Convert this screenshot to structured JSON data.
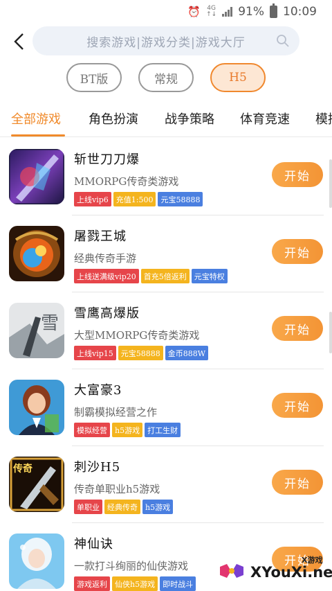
{
  "status_bar": {
    "network_top": "4G",
    "network_bottom": "↑↓",
    "battery": "91%",
    "time": "10:09"
  },
  "search": {
    "placeholder": "搜索游戏|游戏分类|游戏大厅"
  },
  "versions": [
    {
      "label": "BT版",
      "active": false
    },
    {
      "label": "常规",
      "active": false
    },
    {
      "label": "H5",
      "active": true
    }
  ],
  "tabs": [
    {
      "label": "全部游戏",
      "active": true
    },
    {
      "label": "角色扮演",
      "active": false
    },
    {
      "label": "战争策略",
      "active": false
    },
    {
      "label": "体育竞速",
      "active": false
    },
    {
      "label": "模拟",
      "active": false
    }
  ],
  "colors": {
    "accent": "#f08a2b",
    "tag_red": "#e6454a",
    "tag_yellow": "#f4b41e",
    "tag_blue": "#4a7fe0"
  },
  "start_label": "开始",
  "games": [
    {
      "title": "斩世刀刀爆",
      "desc": "MMORPG传奇类游戏",
      "icon": "sword-warrior-game-icon",
      "tags": [
        {
          "text": "上线vip6",
          "color": "red"
        },
        {
          "text": "充值1:500",
          "color": "yellow"
        },
        {
          "text": "元宝58888",
          "color": "blue"
        }
      ]
    },
    {
      "title": "屠戮王城",
      "desc": "经典传奇手游",
      "icon": "fire-orb-game-icon",
      "tags": [
        {
          "text": "上线送满级vip20",
          "color": "red"
        },
        {
          "text": "首充5倍返利",
          "color": "yellow"
        },
        {
          "text": "元宝特权",
          "color": "blue"
        }
      ]
    },
    {
      "title": "雪鹰高爆版",
      "desc": "大型MMORPG传奇类游戏",
      "icon": "snow-eagle-game-icon",
      "tags": [
        {
          "text": "上线vip15",
          "color": "red"
        },
        {
          "text": "元宝58888",
          "color": "yellow"
        },
        {
          "text": "金币888W",
          "color": "blue"
        }
      ]
    },
    {
      "title": "大富豪3",
      "desc": "制霸模拟经营之作",
      "icon": "business-woman-game-icon",
      "tags": [
        {
          "text": "模拟经营",
          "color": "red"
        },
        {
          "text": "h5游戏",
          "color": "yellow"
        },
        {
          "text": "打工生财",
          "color": "blue"
        }
      ]
    },
    {
      "title": "刺沙H5",
      "desc": "传奇单职业h5游戏",
      "icon": "legend-blade-game-icon",
      "tags": [
        {
          "text": "单职业",
          "color": "red"
        },
        {
          "text": "经典传奇",
          "color": "yellow"
        },
        {
          "text": "h5游戏",
          "color": "blue"
        }
      ]
    },
    {
      "title": "神仙诀",
      "desc": "一款打斗绚丽的仙侠游戏",
      "icon": "fairy-game-icon",
      "tags": [
        {
          "text": "游戏返利",
          "color": "red"
        },
        {
          "text": "仙侠h5游戏",
          "color": "yellow"
        },
        {
          "text": "即时战斗",
          "color": "blue"
        }
      ]
    }
  ],
  "thumb_texts": {
    "snow_eagle_char": "雪",
    "legend_label": "传奇"
  },
  "watermark": {
    "small": "X游戏",
    "big": "XYouXi.net"
  }
}
